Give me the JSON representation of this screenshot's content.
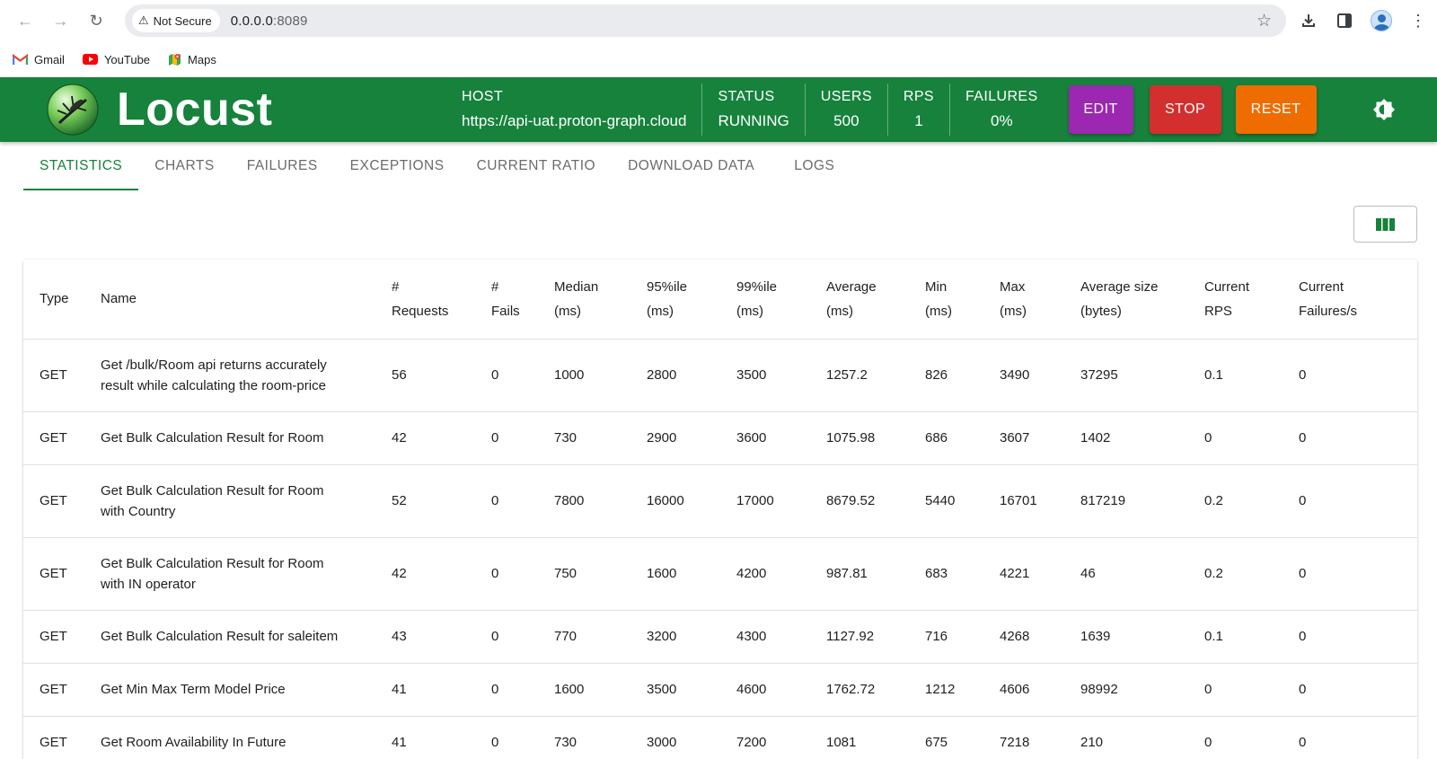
{
  "browser": {
    "security_label": "Not Secure",
    "url_host": "0.0.0.0",
    "url_port": ":8089",
    "bookmarks": [
      {
        "label": "Gmail",
        "icon": "gmail-icon"
      },
      {
        "label": "YouTube",
        "icon": "youtube-icon"
      },
      {
        "label": "Maps",
        "icon": "maps-icon"
      }
    ]
  },
  "header": {
    "logo_text": "Locust",
    "host_label": "HOST",
    "host_value": "https://api-uat.proton-graph.cloud",
    "status_label": "STATUS",
    "status_value": "RUNNING",
    "users_label": "USERS",
    "users_value": "500",
    "rps_label": "RPS",
    "rps_value": "1",
    "failures_label": "FAILURES",
    "failures_value": "0%",
    "edit_label": "EDIT",
    "stop_label": "STOP",
    "reset_label": "RESET",
    "colors": {
      "bar": "#16823c",
      "edit": "#9c27b0",
      "stop": "#d32f2f",
      "reset": "#ef6c00"
    }
  },
  "tabs": [
    {
      "label": "STATISTICS",
      "active": true
    },
    {
      "label": "CHARTS"
    },
    {
      "label": "FAILURES"
    },
    {
      "label": "EXCEPTIONS"
    },
    {
      "label": "CURRENT RATIO"
    },
    {
      "label": "DOWNLOAD DATA"
    },
    {
      "label": "LOGS"
    }
  ],
  "table": {
    "columns": [
      {
        "line1": "Type",
        "line2": ""
      },
      {
        "line1": "Name",
        "line2": ""
      },
      {
        "line1": "#",
        "line2": "Requests"
      },
      {
        "line1": "#",
        "line2": "Fails"
      },
      {
        "line1": "Median",
        "line2": "(ms)"
      },
      {
        "line1": "95%ile",
        "line2": "(ms)"
      },
      {
        "line1": "99%ile",
        "line2": "(ms)"
      },
      {
        "line1": "Average",
        "line2": "(ms)"
      },
      {
        "line1": "Min",
        "line2": "(ms)"
      },
      {
        "line1": "Max",
        "line2": "(ms)"
      },
      {
        "line1": "Average size",
        "line2": "(bytes)"
      },
      {
        "line1": "Current",
        "line2": "RPS"
      },
      {
        "line1": "Current",
        "line2": "Failures/s"
      }
    ],
    "rows": [
      [
        "GET",
        "Get /bulk/Room api returns accurately result while calculating the room-price",
        "56",
        "0",
        "1000",
        "2800",
        "3500",
        "1257.2",
        "826",
        "3490",
        "37295",
        "0.1",
        "0"
      ],
      [
        "GET",
        "Get Bulk Calculation Result for Room",
        "42",
        "0",
        "730",
        "2900",
        "3600",
        "1075.98",
        "686",
        "3607",
        "1402",
        "0",
        "0"
      ],
      [
        "GET",
        "Get Bulk Calculation Result for Room with Country",
        "52",
        "0",
        "7800",
        "16000",
        "17000",
        "8679.52",
        "5440",
        "16701",
        "817219",
        "0.2",
        "0"
      ],
      [
        "GET",
        "Get Bulk Calculation Result for Room with IN operator",
        "42",
        "0",
        "750",
        "1600",
        "4200",
        "987.81",
        "683",
        "4221",
        "46",
        "0.2",
        "0"
      ],
      [
        "GET",
        "Get Bulk Calculation Result for saleitem",
        "43",
        "0",
        "770",
        "3200",
        "4300",
        "1127.92",
        "716",
        "4268",
        "1639",
        "0.1",
        "0"
      ],
      [
        "GET",
        "Get Min Max Term Model Price",
        "41",
        "0",
        "1600",
        "3500",
        "4600",
        "1762.72",
        "1212",
        "4606",
        "98992",
        "0",
        "0"
      ],
      [
        "GET",
        "Get Room Availability In Future",
        "41",
        "0",
        "730",
        "3000",
        "7200",
        "1081",
        "675",
        "7218",
        "210",
        "0",
        "0"
      ]
    ]
  }
}
